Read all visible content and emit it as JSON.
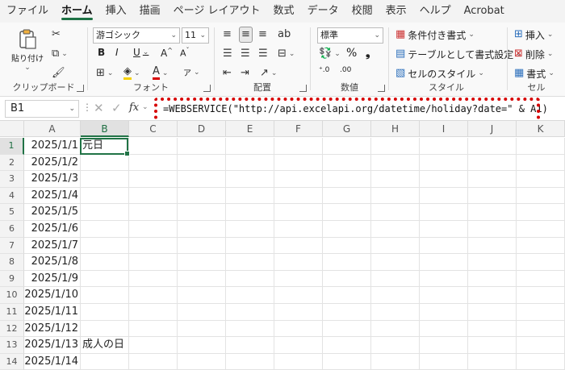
{
  "menu": [
    "ファイル",
    "ホーム",
    "挿入",
    "描画",
    "ページ レイアウト",
    "数式",
    "データ",
    "校閲",
    "表示",
    "ヘルプ",
    "Acrobat"
  ],
  "ribbon": {
    "clipboard": {
      "paste": "貼り付け",
      "label": "クリップボード"
    },
    "font": {
      "name": "游ゴシック",
      "size": "11",
      "label": "フォント"
    },
    "alignment": {
      "label": "配置"
    },
    "number": {
      "format": "標準",
      "label": "数値"
    },
    "styles": {
      "conditional": "条件付き書式",
      "table": "テーブルとして書式設定",
      "cell": "セルのスタイル",
      "label": "スタイル"
    },
    "cells": {
      "insert": "挿入",
      "delete": "削除",
      "format": "書式",
      "label": "セル"
    }
  },
  "formula_bar": {
    "name_box": "B1",
    "fx": "fx",
    "formula": "=WEBSERVICE(\"http://api.excelapi.org/datetime/holiday?date=\" & A1)"
  },
  "columns": [
    "A",
    "B",
    "C",
    "D",
    "E",
    "F",
    "G",
    "H",
    "I",
    "J",
    "K"
  ],
  "rows": [
    {
      "n": "1",
      "a": "2025/1/1",
      "b": "元日"
    },
    {
      "n": "2",
      "a": "2025/1/2",
      "b": ""
    },
    {
      "n": "3",
      "a": "2025/1/3",
      "b": ""
    },
    {
      "n": "4",
      "a": "2025/1/4",
      "b": ""
    },
    {
      "n": "5",
      "a": "2025/1/5",
      "b": ""
    },
    {
      "n": "6",
      "a": "2025/1/6",
      "b": ""
    },
    {
      "n": "7",
      "a": "2025/1/7",
      "b": ""
    },
    {
      "n": "8",
      "a": "2025/1/8",
      "b": ""
    },
    {
      "n": "9",
      "a": "2025/1/9",
      "b": ""
    },
    {
      "n": "10",
      "a": "2025/1/10",
      "b": ""
    },
    {
      "n": "11",
      "a": "2025/1/11",
      "b": ""
    },
    {
      "n": "12",
      "a": "2025/1/12",
      "b": ""
    },
    {
      "n": "13",
      "a": "2025/1/13",
      "b": "成人の日"
    },
    {
      "n": "14",
      "a": "2025/1/14",
      "b": ""
    }
  ],
  "colors": {
    "accent": "#217346",
    "highlight": "#d60000"
  }
}
